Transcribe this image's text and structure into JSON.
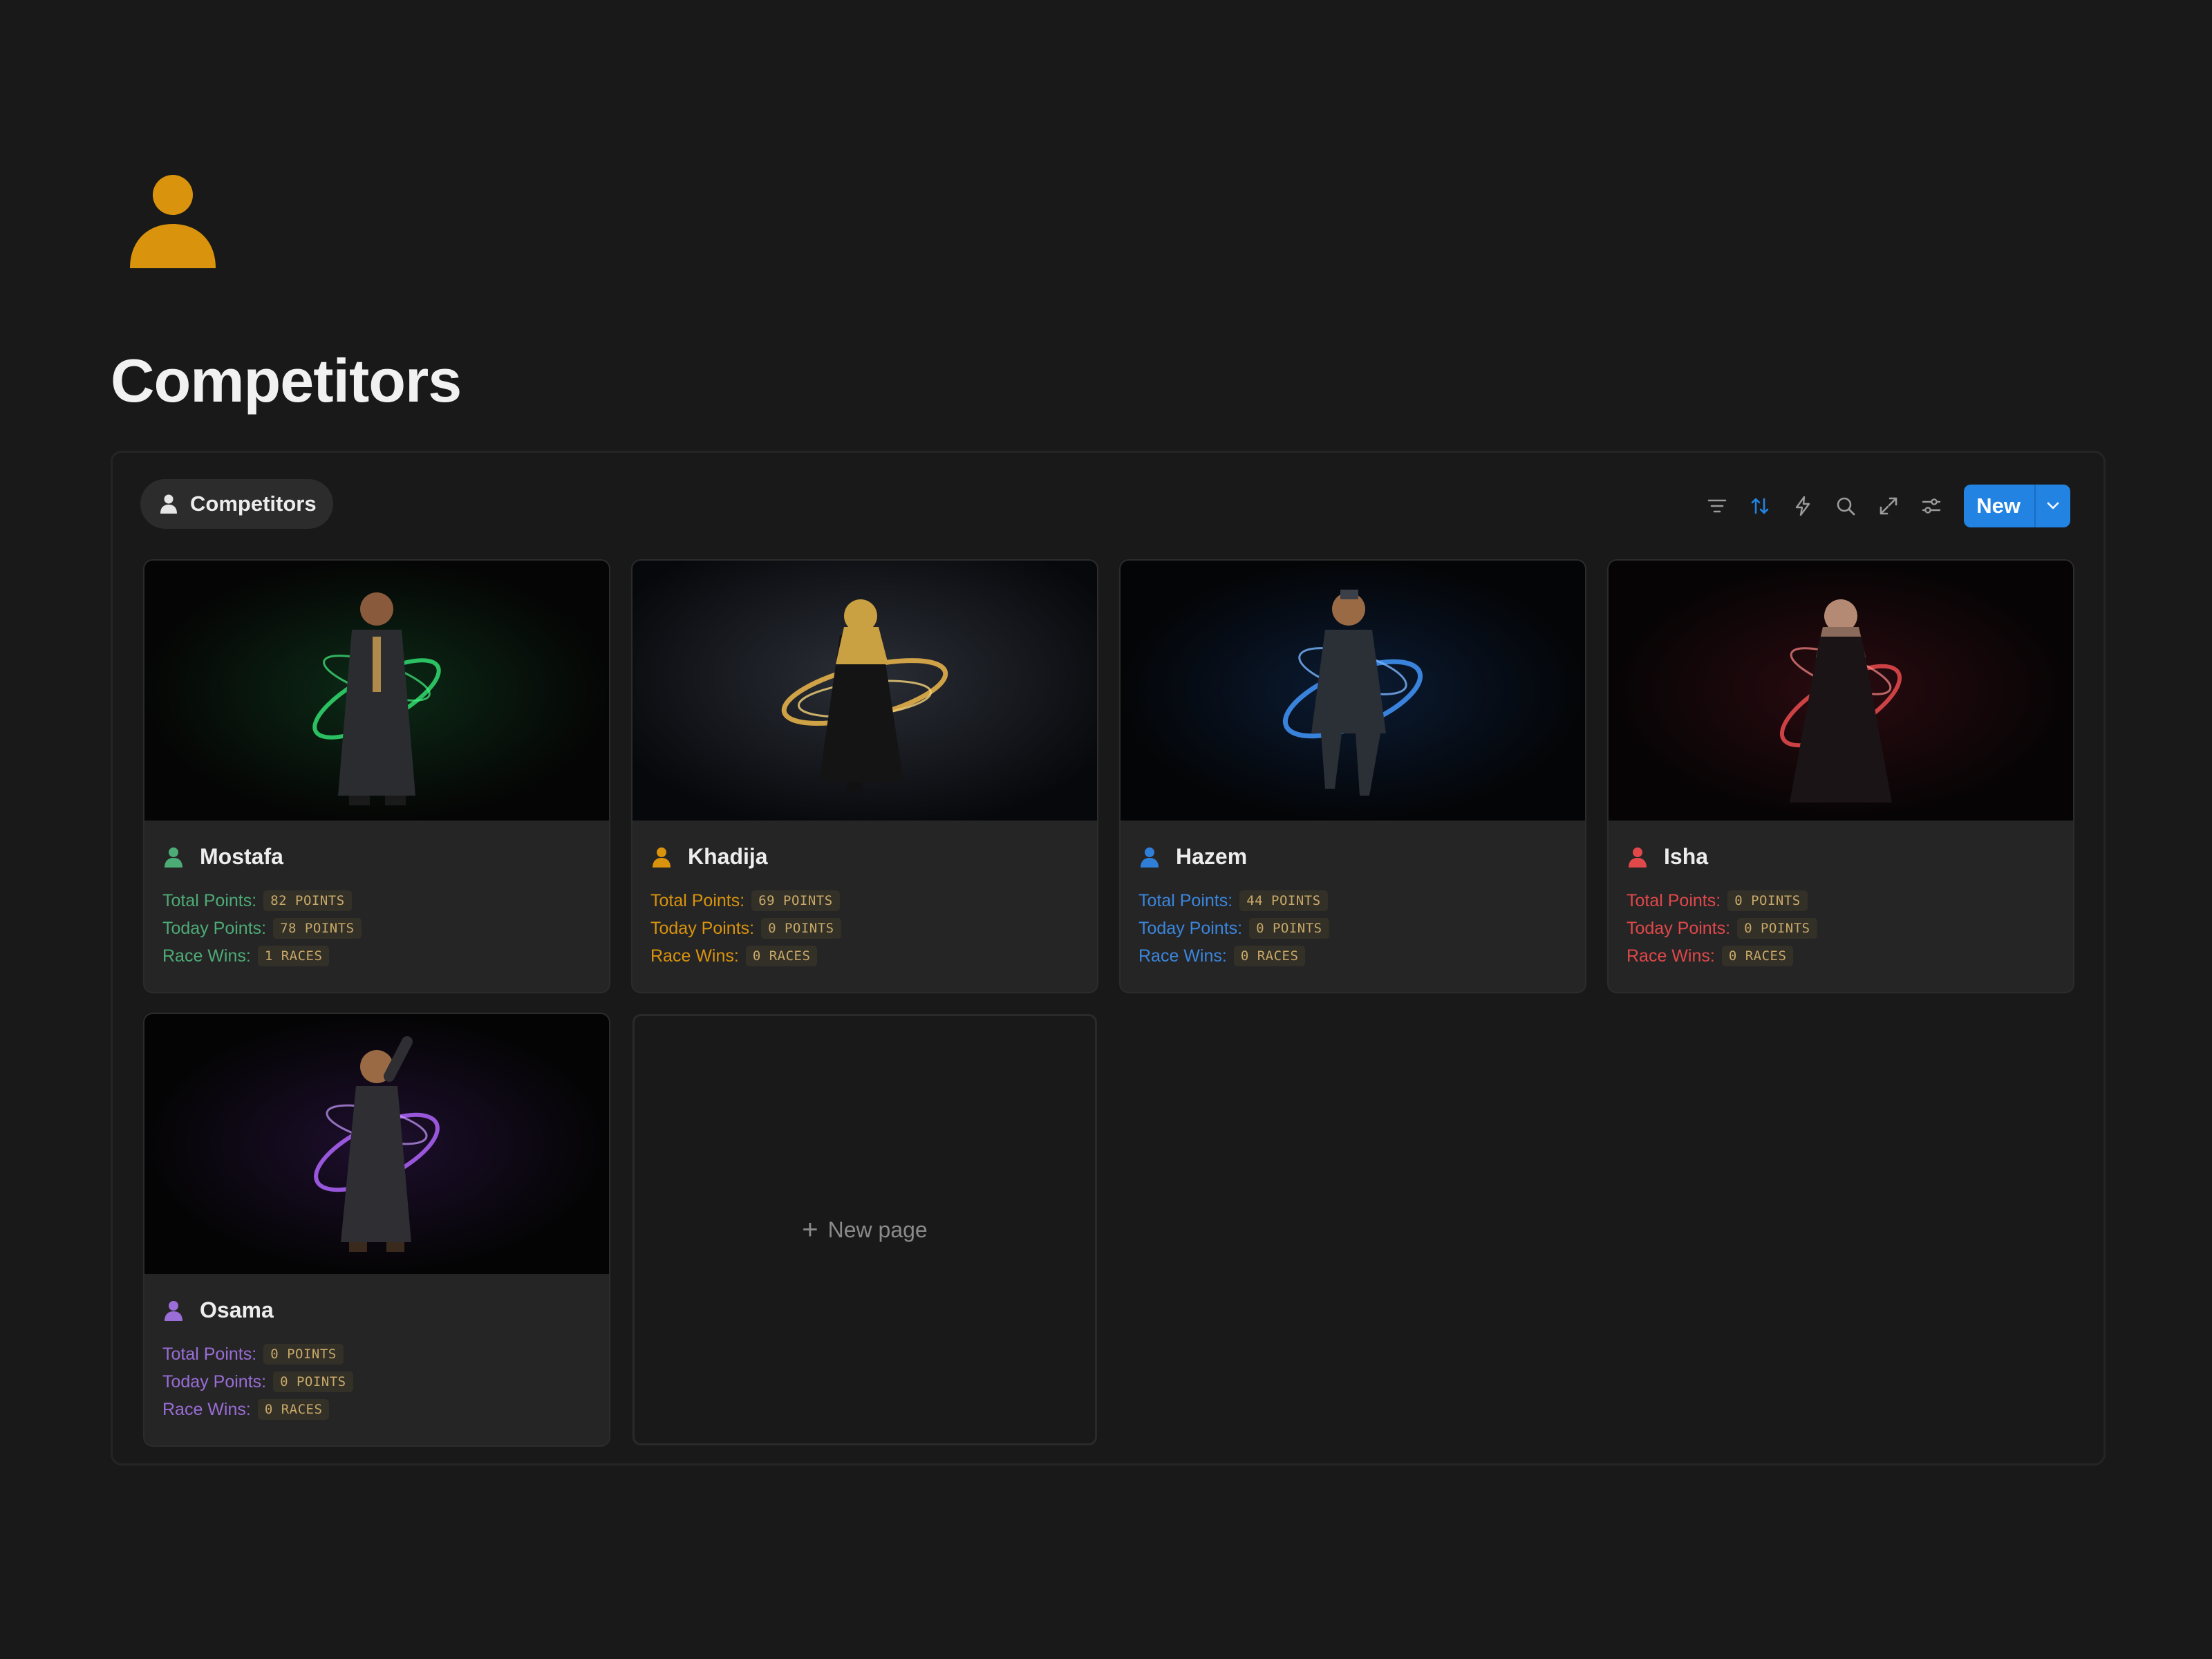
{
  "page": {
    "icon": "person-icon",
    "icon_color": "#d9930d",
    "title": "Competitors"
  },
  "view": {
    "tab_label": "Competitors",
    "tab_icon": "person-icon"
  },
  "toolbar": {
    "icons": [
      "filter-icon",
      "sort-icon",
      "automation-icon",
      "search-icon",
      "expand-icon",
      "settings-icon"
    ],
    "accent_sort": "#2383e2",
    "new_label": "New"
  },
  "labels": {
    "total": "Total Points:",
    "today": "Today Points:",
    "wins": "Race Wins:"
  },
  "cards": [
    {
      "name": "Mostafa",
      "color": "#4dab76",
      "total": "82 POINTS",
      "today": "78 POINTS",
      "wins": "1 RACES"
    },
    {
      "name": "Khadija",
      "color": "#d9930d",
      "total": "69 POINTS",
      "today": "0 POINTS",
      "wins": "0 RACES"
    },
    {
      "name": "Hazem",
      "color": "#2f7fd8",
      "total": "44 POINTS",
      "today": "0 POINTS",
      "wins": "0 RACES"
    },
    {
      "name": "Isha",
      "color": "#e0484a",
      "total": "0 POINTS",
      "today": "0 POINTS",
      "wins": "0 RACES"
    },
    {
      "name": "Osama",
      "color": "#9a6dd7",
      "total": "0 POINTS",
      "today": "0 POINTS",
      "wins": "0 RACES"
    }
  ],
  "new_page": {
    "label": "New page"
  }
}
